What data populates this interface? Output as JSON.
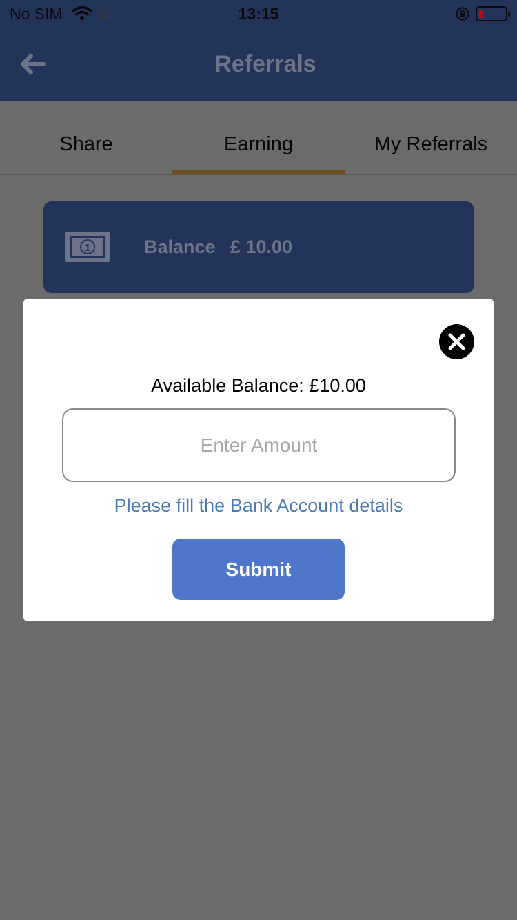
{
  "status_bar": {
    "carrier": "No SIM",
    "time": "13:15"
  },
  "header": {
    "title": "Referrals",
    "back_icon": "arrow-left-icon"
  },
  "tabs": [
    {
      "label": "Share",
      "active": false
    },
    {
      "label": "Earning",
      "active": true
    },
    {
      "label": "My Referrals",
      "active": false
    }
  ],
  "balance_card": {
    "icon": "banknote-icon",
    "label": "Balance",
    "value": "£ 10.00"
  },
  "modal": {
    "available_balance": "Available Balance: £10.00",
    "amount_input": {
      "value": "",
      "placeholder": "Enter Amount"
    },
    "bank_details_link": "Please fill the Bank Account details",
    "submit_label": "Submit",
    "close_icon": "close-icon"
  },
  "colors": {
    "header_bg": "#223459",
    "overlay": "#6b6b6b",
    "tab_indicator": "#6e4c1e",
    "link": "#4b7ab7",
    "submit_bg": "#4e77c9"
  }
}
